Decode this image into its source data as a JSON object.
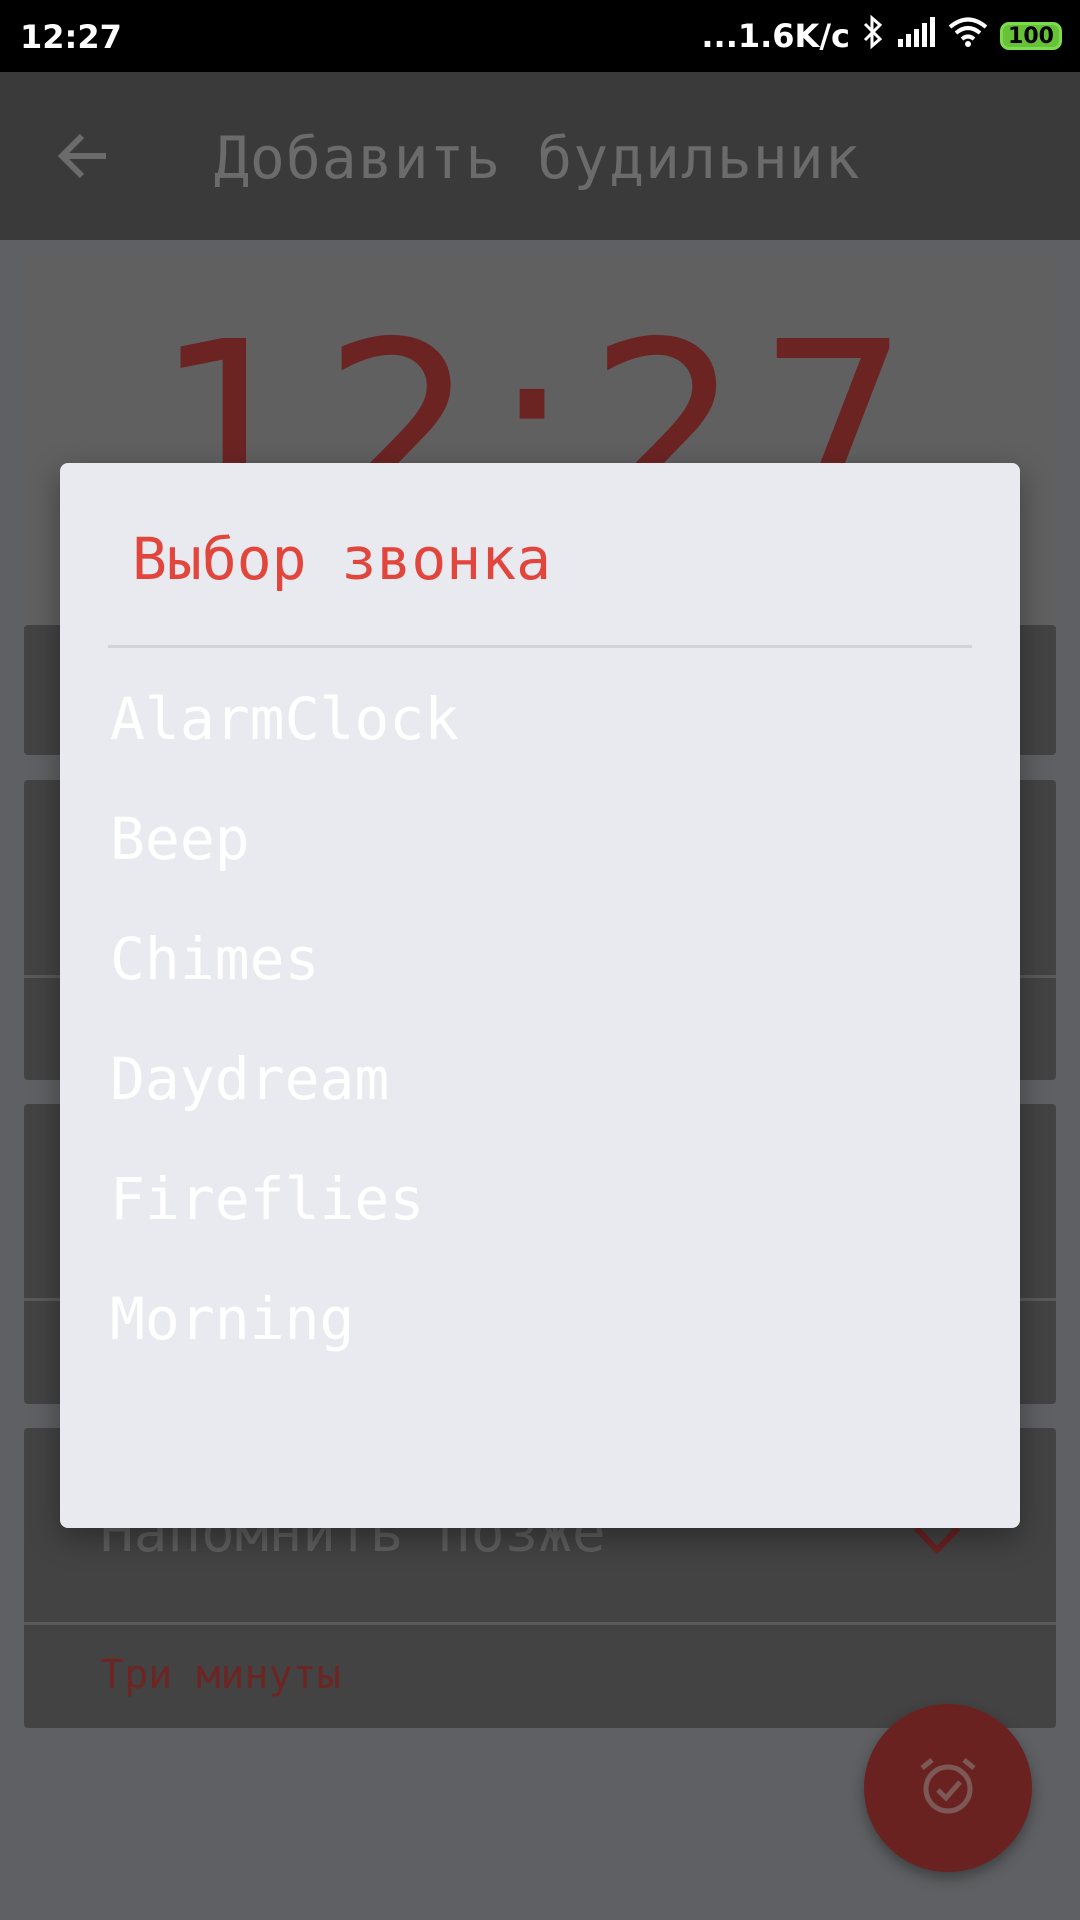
{
  "status_bar": {
    "time": "12:27",
    "network_speed": "...1.6K/c",
    "battery": "100"
  },
  "app_bar": {
    "title": "Добавить будильник"
  },
  "background": {
    "clock_time": "12:27",
    "snooze_title": "Напомнить позже",
    "snooze_value": "Три минуты"
  },
  "dialog": {
    "title": "Выбор звонка",
    "items": [
      {
        "label": "AlarmClock"
      },
      {
        "label": "Beep"
      },
      {
        "label": "Chimes"
      },
      {
        "label": "Daydream"
      },
      {
        "label": "Fireflies"
      },
      {
        "label": "Morning"
      }
    ]
  },
  "colors": {
    "accent": "#e2453c",
    "dialog_bg": "#e9eaef",
    "fab": "#6a2221"
  }
}
